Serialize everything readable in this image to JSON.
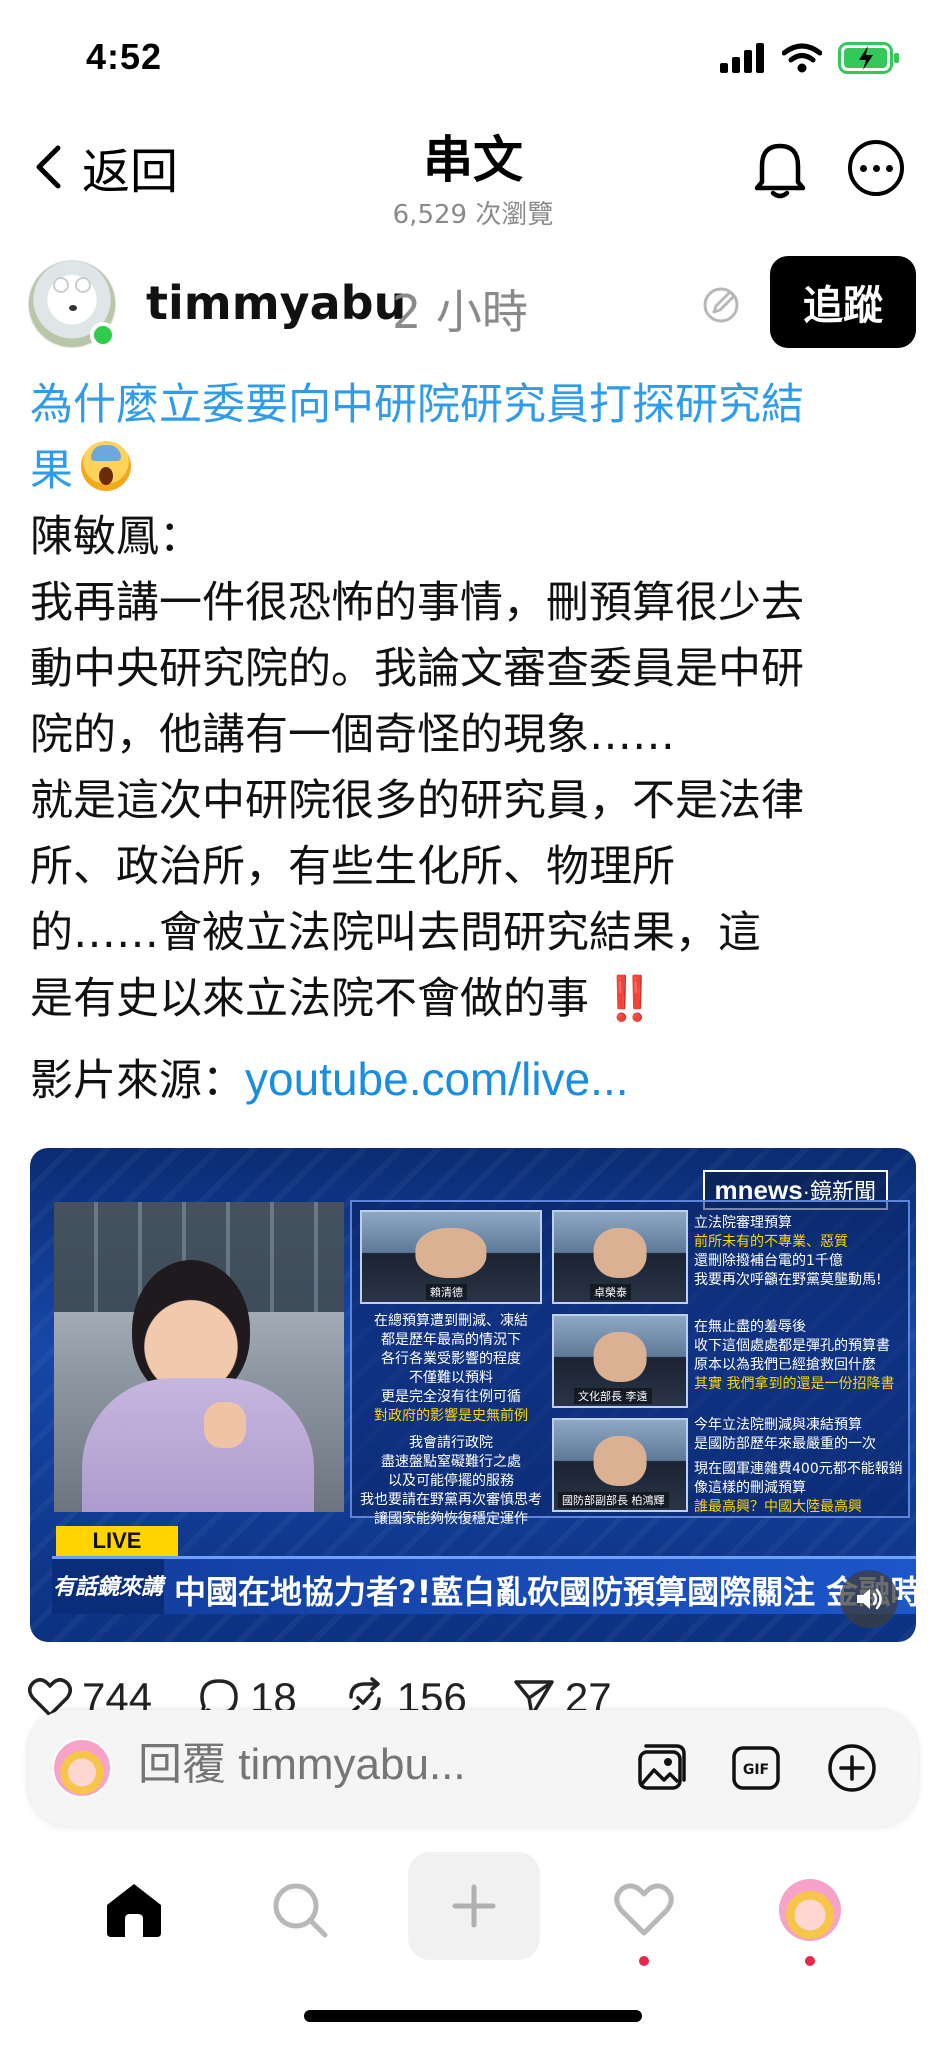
{
  "status_bar": {
    "time": "4:52"
  },
  "header": {
    "back_label": "返回",
    "title": "串文",
    "views": "6,529 次瀏覽"
  },
  "author": {
    "username": "timmyabu",
    "time_ago": "2 小時",
    "follow_label": "追蹤"
  },
  "post": {
    "headline_line1": "為什麼立委要向中研院研究員打探研究結",
    "headline_line2": "果",
    "speaker": "陳敏鳳：",
    "para1_line1": "我再講一件很恐怖的事情，刪預算很少去",
    "para1_line2": "動中央研究院的。我論文審查委員是中研",
    "para1_line3": "院的，他講有一個奇怪的現象……",
    "para2_line1": "就是這次中研院很多的研究員，不是法律",
    "para2_line2": "所、政治所，有些生化所、物理所",
    "para2_line3": "的……會被立法院叫去問研究結果，這",
    "para2_line4": "是有史以來立法院不會做的事",
    "double_exclaim": "‼️",
    "source_label": "影片來源：",
    "source_link": "youtube.com/live..."
  },
  "video": {
    "channel_tag_a": "mnews",
    "channel_tag_b": "·鏡新聞",
    "live_label": "LIVE",
    "show_logo": "有話鏡來講",
    "ticker": "中國在地協力者?!藍白亂砍國防預算國際關注 金融時報:恐冒與川普疏遠風險",
    "name_1": "賴清德",
    "name_2": "卓榮泰",
    "name_3": "文化部長 李遠",
    "name_4": "國防部副部長 柏鴻輝",
    "text_mid_1": "在總預算遭到刪減、凍結",
    "text_mid_2": "都是歷年最高的情況下",
    "text_mid_3": "各行各業受影響的程度",
    "text_mid_4": "不僅難以預料",
    "text_mid_5": "更是完全沒有往例可循",
    "text_mid_6": "對政府的影響是史無前例",
    "text_mid_7": "我會請行政院",
    "text_mid_8": "盡速盤點窒礙難行之處",
    "text_mid_9": "以及可能停擺的服務",
    "text_mid_10": "我也要請在野黨再次審慎思考",
    "text_mid_11": "讓國家能夠恢復穩定運作",
    "text_r1_1": "立法院審理預算",
    "text_r1_2": "前所未有的不專業、惡質",
    "text_r1_3": "還刪除撥補台電的1千億",
    "text_r1_4": "我要再次呼籲在野黨莫壟動馬!",
    "text_r2_1": "在無止盡的羞辱後",
    "text_r2_2": "收下這個處處都是彈孔的預算書",
    "text_r2_3": "原本以為我們已經搶救回什麼",
    "text_r2_4": "其實 我們拿到的還是一份招降書",
    "text_r3_1": "今年立法院刪減與凍結預算",
    "text_r3_2": "是國防部歷年來最嚴重的一次",
    "text_r3_3": "現在國軍連雜費400元都不能報銷",
    "text_r3_4": "像這樣的刪減預算",
    "text_r3_5": "誰最高興？中國大陸最高興"
  },
  "actions": {
    "likes": "744",
    "comments": "18",
    "reposts": "156",
    "shares": "27"
  },
  "composer": {
    "placeholder": "回覆 timmyabu..."
  },
  "icons": {
    "back": "chevron-left-icon",
    "bell": "bell-icon",
    "more": "more-horizontal-icon",
    "edit": "edit-pencil-icon",
    "like": "heart-icon",
    "comment": "comment-bubble-icon",
    "repost": "repost-icon",
    "share": "send-icon",
    "gallery": "gallery-icon",
    "gif": "gif-icon",
    "add": "plus-circle-icon",
    "home": "home-icon",
    "search": "search-icon",
    "create": "plus-icon",
    "activity": "heart-icon",
    "mute": "speaker-icon"
  },
  "colors": {
    "link_blue": "#1a8de0",
    "headline_blue": "#2f9ceb",
    "online_green": "#2ecc4a",
    "notification_red": "#e8264f",
    "battery_green": "#34c759"
  }
}
